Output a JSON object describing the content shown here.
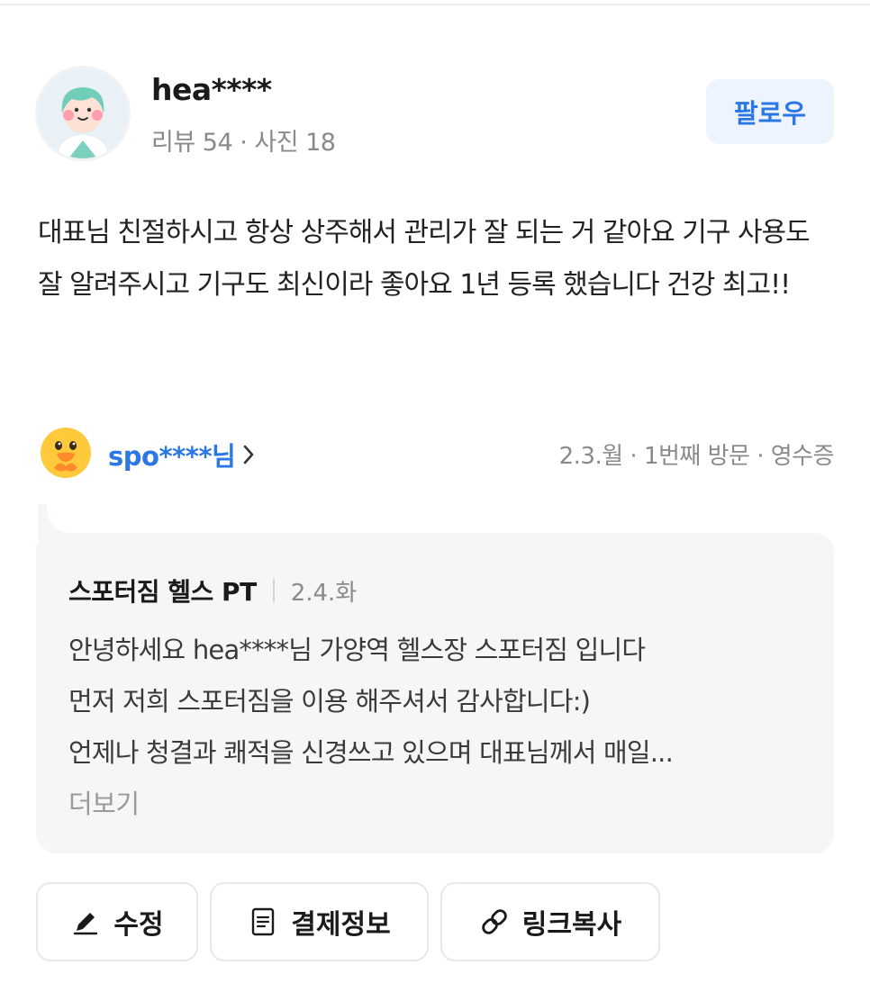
{
  "user": {
    "name": "hea****",
    "stats": "리뷰 54 · 사진 18",
    "follow_label": "팔로우"
  },
  "review": {
    "text": "대표님 친절하시고 항상 상주해서 관리가 잘 되는 거 같아요 기구 사용도 잘 알려주시고 기구도 최신이라 좋아요 1년 등록 했습니다 건강 최고!!"
  },
  "visit": {
    "owner_name": "spo****님",
    "meta": "2.3.월 · 1번째 방문 · 영수증"
  },
  "reply": {
    "business_name": "스포터짐 헬스 PT",
    "date": "2.4.화",
    "lines": [
      "안녕하세요 hea****님 가양역 헬스장 스포터짐 입니다",
      "먼저 저희 스포터짐을 이용 해주셔서 감사합니다:)",
      "언제나 청결과 쾌적을 신경쓰고 있으며 대표님께서 매일..."
    ],
    "more_label": "더보기"
  },
  "actions": {
    "edit_label": "수정",
    "payment_label": "결제정보",
    "copy_link_label": "링크복사"
  },
  "colors": {
    "accent": "#2b77e5",
    "follow_bg": "#eef4fd",
    "reply_bg": "#f5f6f8",
    "muted_text": "#8a8a8a"
  },
  "icons": {
    "avatar": "user-avatar-illustration",
    "owner_avatar": "duck-emoji-avatar",
    "chevron": "chevron-right-icon",
    "edit": "pencil-icon",
    "payment": "document-icon",
    "link": "link-icon"
  }
}
